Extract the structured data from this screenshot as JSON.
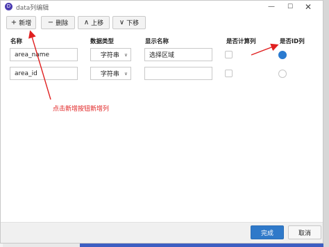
{
  "window": {
    "title": "data列编辑",
    "app_icon_glyph": "D",
    "controls": {
      "minimize": "—",
      "maximize": "☐",
      "close": "✕"
    }
  },
  "toolbar": {
    "add": {
      "icon": "+",
      "label": "新增"
    },
    "delete": {
      "icon": "−",
      "label": "删除"
    },
    "move_up": {
      "icon": "∧",
      "label": "上移"
    },
    "move_down": {
      "icon": "∨",
      "label": "下移"
    }
  },
  "columns": {
    "name": "名称",
    "type": "数据类型",
    "display": "显示名称",
    "is_calc": "是否计算列",
    "is_id": "是否ID列"
  },
  "rows": [
    {
      "name": "area_name",
      "type": "字符串",
      "display": "选择区域",
      "is_calc": false,
      "is_id": true
    },
    {
      "name": "area_id",
      "type": "字符串",
      "display": "",
      "is_calc": false,
      "is_id": false
    }
  ],
  "annotation": {
    "text": "点击新增按钮新增列",
    "color": "#e02020"
  },
  "footer": {
    "finish": "完成",
    "cancel": "取消"
  },
  "colors": {
    "accent": "#2f79c9",
    "radio_checked": "#2b7bd0",
    "annotation": "#e02020"
  }
}
